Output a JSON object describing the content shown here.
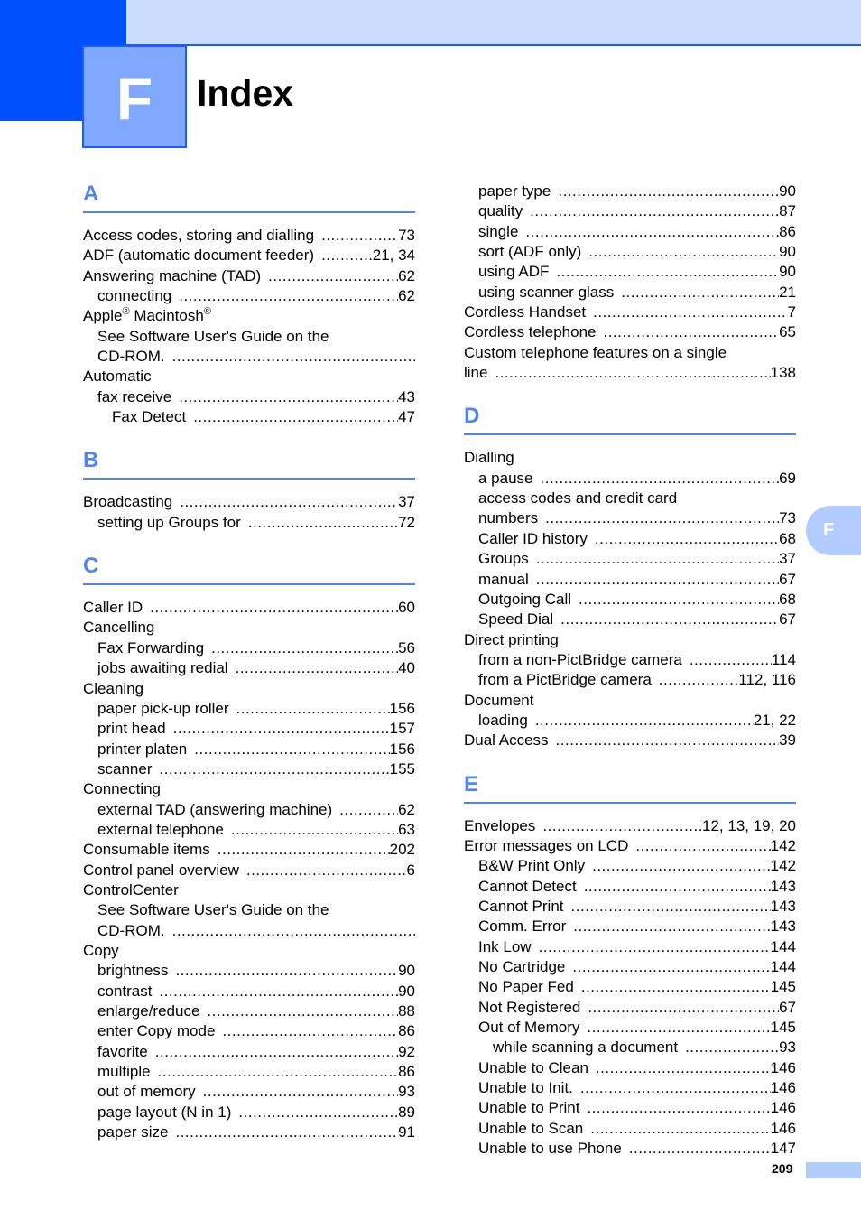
{
  "chapter": {
    "letter": "F",
    "title": "Index"
  },
  "thumb_tab": "F",
  "page_number": "209",
  "colors": {
    "accent": "#4d86f2",
    "corner": "#0050ff",
    "band": "#ccdcff",
    "chapter_box": "#80a8ff",
    "tab": "#b3ccff"
  },
  "left_column": [
    {
      "type": "section",
      "letter": "A"
    },
    {
      "type": "entry",
      "level": 0,
      "term": "Access codes, storing and dialling",
      "pages": "73"
    },
    {
      "type": "entry",
      "level": 0,
      "term": "ADF (automatic document feeder)",
      "pages": "21, 34"
    },
    {
      "type": "entry",
      "level": 0,
      "term": "Answering machine (TAD)",
      "pages": "62"
    },
    {
      "type": "entry",
      "level": 1,
      "term": "connecting",
      "pages": "62"
    },
    {
      "type": "entry",
      "level": 0,
      "term": "Apple® Macintosh®",
      "pages": "",
      "noleader": true,
      "sup": true
    },
    {
      "type": "entry",
      "level": 1,
      "term": "See Software User's Guide on the",
      "pages": "",
      "noleader": true
    },
    {
      "type": "entry",
      "level": 1,
      "term": "CD-ROM.",
      "pages": ""
    },
    {
      "type": "entry",
      "level": 0,
      "term": "Automatic",
      "pages": "",
      "noleader": true
    },
    {
      "type": "entry",
      "level": 1,
      "term": "fax receive",
      "pages": "43"
    },
    {
      "type": "entry",
      "level": 2,
      "term": "Fax Detect",
      "pages": "47"
    },
    {
      "type": "section",
      "letter": "B"
    },
    {
      "type": "entry",
      "level": 0,
      "term": "Broadcasting",
      "pages": "37"
    },
    {
      "type": "entry",
      "level": 1,
      "term": "setting up Groups for",
      "pages": "72"
    },
    {
      "type": "section",
      "letter": "C"
    },
    {
      "type": "entry",
      "level": 0,
      "term": "Caller ID",
      "pages": "60"
    },
    {
      "type": "entry",
      "level": 0,
      "term": "Cancelling",
      "pages": "",
      "noleader": true
    },
    {
      "type": "entry",
      "level": 1,
      "term": "Fax Forwarding",
      "pages": "56"
    },
    {
      "type": "entry",
      "level": 1,
      "term": "jobs awaiting redial",
      "pages": "40"
    },
    {
      "type": "entry",
      "level": 0,
      "term": "Cleaning",
      "pages": "",
      "noleader": true
    },
    {
      "type": "entry",
      "level": 1,
      "term": "paper pick-up roller",
      "pages": "156"
    },
    {
      "type": "entry",
      "level": 1,
      "term": "print head",
      "pages": "157"
    },
    {
      "type": "entry",
      "level": 1,
      "term": "printer platen",
      "pages": "156"
    },
    {
      "type": "entry",
      "level": 1,
      "term": "scanner",
      "pages": "155"
    },
    {
      "type": "entry",
      "level": 0,
      "term": "Connecting",
      "pages": "",
      "noleader": true
    },
    {
      "type": "entry",
      "level": 1,
      "term": "external TAD (answering machine)",
      "pages": "62"
    },
    {
      "type": "entry",
      "level": 1,
      "term": "external telephone",
      "pages": "63"
    },
    {
      "type": "entry",
      "level": 0,
      "term": "Consumable items",
      "pages": "202"
    },
    {
      "type": "entry",
      "level": 0,
      "term": "Control panel overview",
      "pages": "6"
    },
    {
      "type": "entry",
      "level": 0,
      "term": "ControlCenter",
      "pages": "",
      "noleader": true
    },
    {
      "type": "entry",
      "level": 1,
      "term": "See Software User's Guide on the",
      "pages": "",
      "noleader": true
    },
    {
      "type": "entry",
      "level": 1,
      "term": "CD-ROM.",
      "pages": ""
    },
    {
      "type": "entry",
      "level": 0,
      "term": "Copy",
      "pages": "",
      "noleader": true
    },
    {
      "type": "entry",
      "level": 1,
      "term": "brightness",
      "pages": "90"
    },
    {
      "type": "entry",
      "level": 1,
      "term": "contrast",
      "pages": "90"
    },
    {
      "type": "entry",
      "level": 1,
      "term": "enlarge/reduce",
      "pages": "88"
    },
    {
      "type": "entry",
      "level": 1,
      "term": "enter Copy mode",
      "pages": "86"
    },
    {
      "type": "entry",
      "level": 1,
      "term": "favorite",
      "pages": "92"
    },
    {
      "type": "entry",
      "level": 1,
      "term": "multiple",
      "pages": "86"
    },
    {
      "type": "entry",
      "level": 1,
      "term": "out of memory",
      "pages": "93"
    },
    {
      "type": "entry",
      "level": 1,
      "term": "page layout (N in 1)",
      "pages": "89"
    },
    {
      "type": "entry",
      "level": 1,
      "term": "paper size",
      "pages": "91"
    }
  ],
  "right_column": [
    {
      "type": "entry",
      "level": 1,
      "term": "paper type",
      "pages": "90"
    },
    {
      "type": "entry",
      "level": 1,
      "term": "quality",
      "pages": "87"
    },
    {
      "type": "entry",
      "level": 1,
      "term": "single",
      "pages": "86"
    },
    {
      "type": "entry",
      "level": 1,
      "term": "sort (ADF only)",
      "pages": "90"
    },
    {
      "type": "entry",
      "level": 1,
      "term": "using ADF",
      "pages": "90"
    },
    {
      "type": "entry",
      "level": 1,
      "term": "using scanner glass",
      "pages": "21"
    },
    {
      "type": "entry",
      "level": 0,
      "term": "Cordless Handset",
      "pages": "7"
    },
    {
      "type": "entry",
      "level": 0,
      "term": "Cordless telephone",
      "pages": "65"
    },
    {
      "type": "entry",
      "level": 0,
      "term": "Custom telephone features on a single",
      "pages": "",
      "noleader": true
    },
    {
      "type": "entry",
      "level": 0,
      "term": "line",
      "pages": "138"
    },
    {
      "type": "section",
      "letter": "D"
    },
    {
      "type": "entry",
      "level": 0,
      "term": "Dialling",
      "pages": "",
      "noleader": true
    },
    {
      "type": "entry",
      "level": 1,
      "term": "a pause",
      "pages": "69"
    },
    {
      "type": "entry",
      "level": 1,
      "term": "access codes and credit card",
      "pages": "",
      "noleader": true
    },
    {
      "type": "entry",
      "level": 1,
      "term": "numbers",
      "pages": "73"
    },
    {
      "type": "entry",
      "level": 1,
      "term": "Caller ID history",
      "pages": "68"
    },
    {
      "type": "entry",
      "level": 1,
      "term": "Groups",
      "pages": "37"
    },
    {
      "type": "entry",
      "level": 1,
      "term": "manual",
      "pages": "67"
    },
    {
      "type": "entry",
      "level": 1,
      "term": "Outgoing Call",
      "pages": "68"
    },
    {
      "type": "entry",
      "level": 1,
      "term": "Speed Dial",
      "pages": "67"
    },
    {
      "type": "entry",
      "level": 0,
      "term": "Direct printing",
      "pages": "",
      "noleader": true
    },
    {
      "type": "entry",
      "level": 1,
      "term": "from a non-PictBridge camera",
      "pages": "114"
    },
    {
      "type": "entry",
      "level": 1,
      "term": "from a PictBridge camera",
      "pages": "112, 116"
    },
    {
      "type": "entry",
      "level": 0,
      "term": "Document",
      "pages": "",
      "noleader": true
    },
    {
      "type": "entry",
      "level": 1,
      "term": "loading",
      "pages": "21, 22"
    },
    {
      "type": "entry",
      "level": 0,
      "term": "Dual Access",
      "pages": "39"
    },
    {
      "type": "section",
      "letter": "E"
    },
    {
      "type": "entry",
      "level": 0,
      "term": "Envelopes",
      "pages": "12, 13, 19, 20"
    },
    {
      "type": "entry",
      "level": 0,
      "term": "Error messages on LCD",
      "pages": "142"
    },
    {
      "type": "entry",
      "level": 1,
      "term": "B&W Print Only",
      "pages": "142"
    },
    {
      "type": "entry",
      "level": 1,
      "term": "Cannot Detect",
      "pages": "143"
    },
    {
      "type": "entry",
      "level": 1,
      "term": "Cannot Print",
      "pages": "143"
    },
    {
      "type": "entry",
      "level": 1,
      "term": "Comm. Error",
      "pages": "143"
    },
    {
      "type": "entry",
      "level": 1,
      "term": "Ink Low",
      "pages": "144"
    },
    {
      "type": "entry",
      "level": 1,
      "term": "No Cartridge",
      "pages": "144"
    },
    {
      "type": "entry",
      "level": 1,
      "term": "No Paper Fed",
      "pages": "145"
    },
    {
      "type": "entry",
      "level": 1,
      "term": "Not Registered",
      "pages": "67"
    },
    {
      "type": "entry",
      "level": 1,
      "term": "Out of Memory",
      "pages": "145"
    },
    {
      "type": "entry",
      "level": 2,
      "term": "while scanning a document",
      "pages": "93"
    },
    {
      "type": "entry",
      "level": 1,
      "term": "Unable to Clean",
      "pages": "146"
    },
    {
      "type": "entry",
      "level": 1,
      "term": "Unable to Init.",
      "pages": "146"
    },
    {
      "type": "entry",
      "level": 1,
      "term": "Unable to Print",
      "pages": "146"
    },
    {
      "type": "entry",
      "level": 1,
      "term": "Unable to Scan",
      "pages": "146"
    },
    {
      "type": "entry",
      "level": 1,
      "term": "Unable to use Phone",
      "pages": "147"
    }
  ]
}
